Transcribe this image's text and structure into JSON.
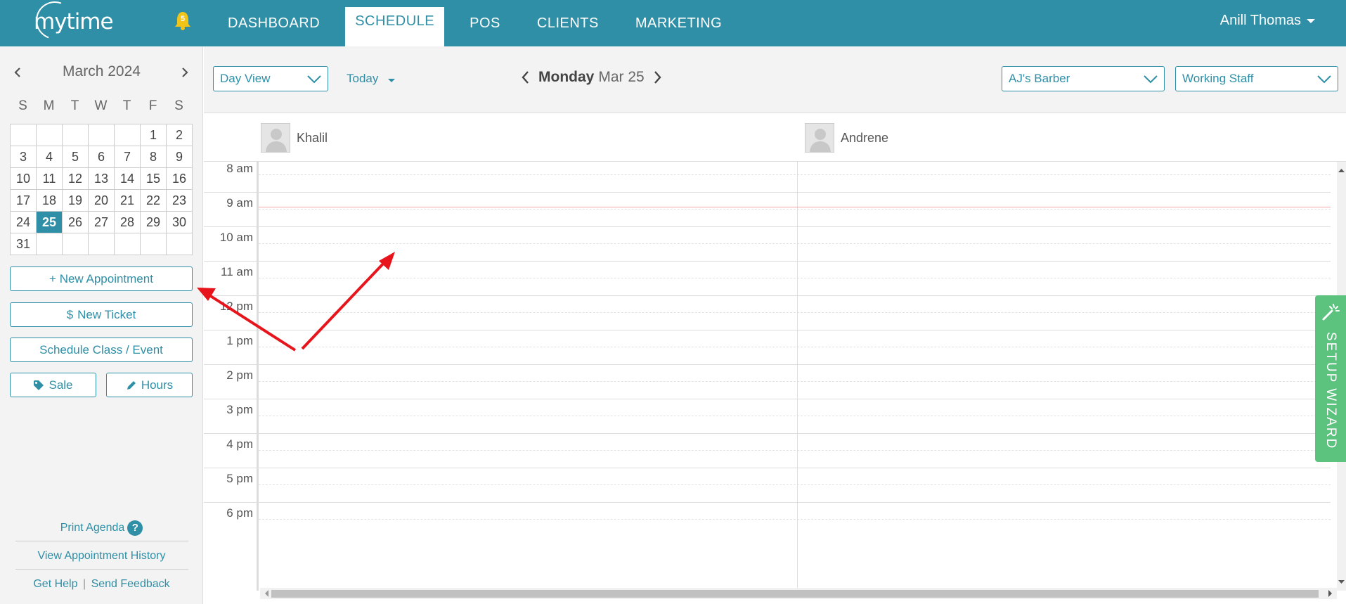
{
  "app": {
    "logo_text": "mytime",
    "notification_count": "5",
    "user_name": "Anill Thomas"
  },
  "nav": {
    "items": [
      "DASHBOARD",
      "SCHEDULE",
      "POS",
      "CLIENTS",
      "MARKETING"
    ],
    "active": "SCHEDULE"
  },
  "calendar": {
    "month_label": "March 2024",
    "weekdays": [
      "S",
      "M",
      "T",
      "W",
      "T",
      "F",
      "S"
    ],
    "weeks": [
      [
        "",
        "",
        "",
        "",
        "",
        "1",
        "2"
      ],
      [
        "3",
        "4",
        "5",
        "6",
        "7",
        "8",
        "9"
      ],
      [
        "10",
        "11",
        "12",
        "13",
        "14",
        "15",
        "16"
      ],
      [
        "17",
        "18",
        "19",
        "20",
        "21",
        "22",
        "23"
      ],
      [
        "24",
        "25",
        "26",
        "27",
        "28",
        "29",
        "30"
      ],
      [
        "31",
        "",
        "",
        "",
        "",
        "",
        ""
      ]
    ],
    "selected_day": "25"
  },
  "sidebar": {
    "new_appointment": "+ New Appointment",
    "new_ticket": "New Ticket",
    "ticket_icon": "$",
    "schedule_class": "Schedule Class / Event",
    "sale": "Sale",
    "hours": "Hours",
    "print_agenda": "Print Agenda",
    "help_badge": "?",
    "view_history": "View Appointment History",
    "get_help": "Get Help",
    "send_feedback": "Send Feedback",
    "link_separator": "|"
  },
  "toolbar": {
    "view_select": "Day View",
    "today": "Today",
    "date_day": "Monday",
    "date_md": "Mar 25",
    "location_select": "AJ's Barber",
    "staff_select": "Working Staff"
  },
  "staff": [
    "Khalil",
    "Andrene"
  ],
  "times": [
    "8 am",
    "9 am",
    "10 am",
    "11 am",
    "12 pm",
    "1 pm",
    "2 pm",
    "3 pm",
    "4 pm",
    "5 pm",
    "6 pm"
  ],
  "setup_wizard": "SETUP WIZARD",
  "colors": {
    "brand": "#2e8fa6",
    "wizard": "#5bc37e",
    "annotation_arrow": "#e8141b",
    "now_line": "#f3a4a8"
  },
  "icons": [
    "bell-icon",
    "chevron-left-icon",
    "chevron-right-icon",
    "chevron-down-icon",
    "tag-icon",
    "pencil-icon",
    "help-icon",
    "magic-wand-icon",
    "avatar-icon"
  ]
}
